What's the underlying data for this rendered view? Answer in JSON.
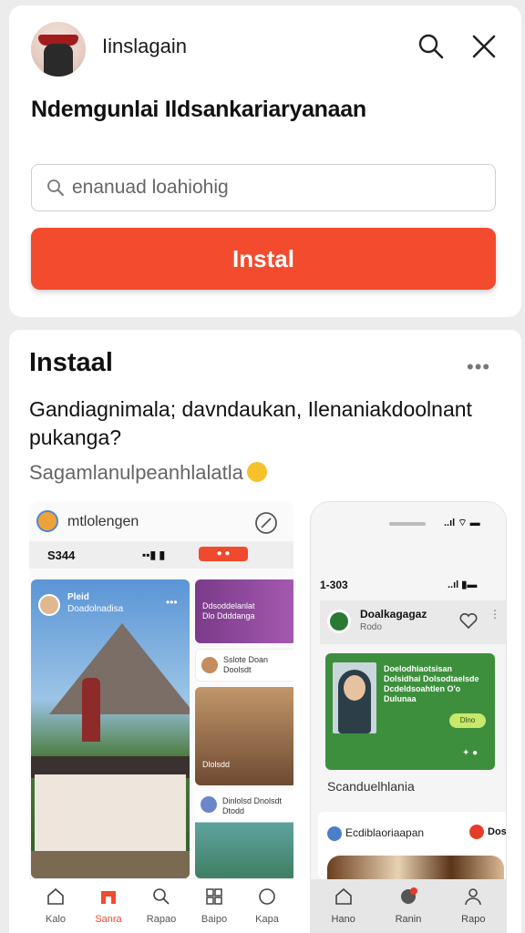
{
  "header": {
    "app_name": "Iinslagain",
    "headline": "Ndemgunlai Ildsankariaryanaan",
    "search_placeholder": "enanuad loahiohig",
    "install_label": "Instal"
  },
  "section": {
    "title": "Instaal",
    "more": "•••",
    "description": "Gandiagnimala; davndaukan, Ilenaniakdoolnant pukanga?",
    "subtitle": "Sagamlanulpeanhlalatla"
  },
  "phone1": {
    "account_name": "mtlolengen",
    "time": "S344",
    "signal": "▪▪▮ ▮",
    "badge": "● ●",
    "hero_title": "Pleid",
    "hero_sub": "Doadolnadisa",
    "hero_more": "•••",
    "tile_a_text": "Ddsoddelanlat Dlo Ddddanga",
    "tile_b_text": "Sslote Doan Doolsdt",
    "tile_c_text": "Dlolsdd",
    "tile_d_text": "Dinlolsd Dnolsdt Dtodd",
    "nav": [
      {
        "label": "Kalo",
        "icon": "home-icon"
      },
      {
        "label": "Sanra",
        "icon": "shop-icon"
      },
      {
        "label": "Rapao",
        "icon": "search-icon"
      },
      {
        "label": "Baipo",
        "icon": "grid-icon"
      },
      {
        "label": "Kapa",
        "icon": "chat-icon"
      }
    ]
  },
  "phone2": {
    "top_signal": "..ıl ⌔ ▬",
    "time": "1-303",
    "signal": "..ıl ▮▬",
    "head_title": "Doalkagagaz",
    "head_sub": "Rodo",
    "head_more": "⋮",
    "card_text": "Doelodhiaotsisan Dolsidhai Dolsodtaelsde Dcdeldsoahtlen O'o Dulunaa",
    "card_button": "Dlno",
    "card_icons": "✦ ●",
    "caption": "Scanduelhlania",
    "card2_title": "Ecdiblaoriaapan",
    "card2_tag": "Dos",
    "nav": [
      {
        "label": "Hano",
        "icon": "home-icon"
      },
      {
        "label": "Ranin",
        "icon": "notification-icon"
      },
      {
        "label": "Rapo",
        "icon": "profile-icon"
      }
    ]
  },
  "colors": {
    "accent": "#f24b2e",
    "green": "#3d8f3d"
  }
}
